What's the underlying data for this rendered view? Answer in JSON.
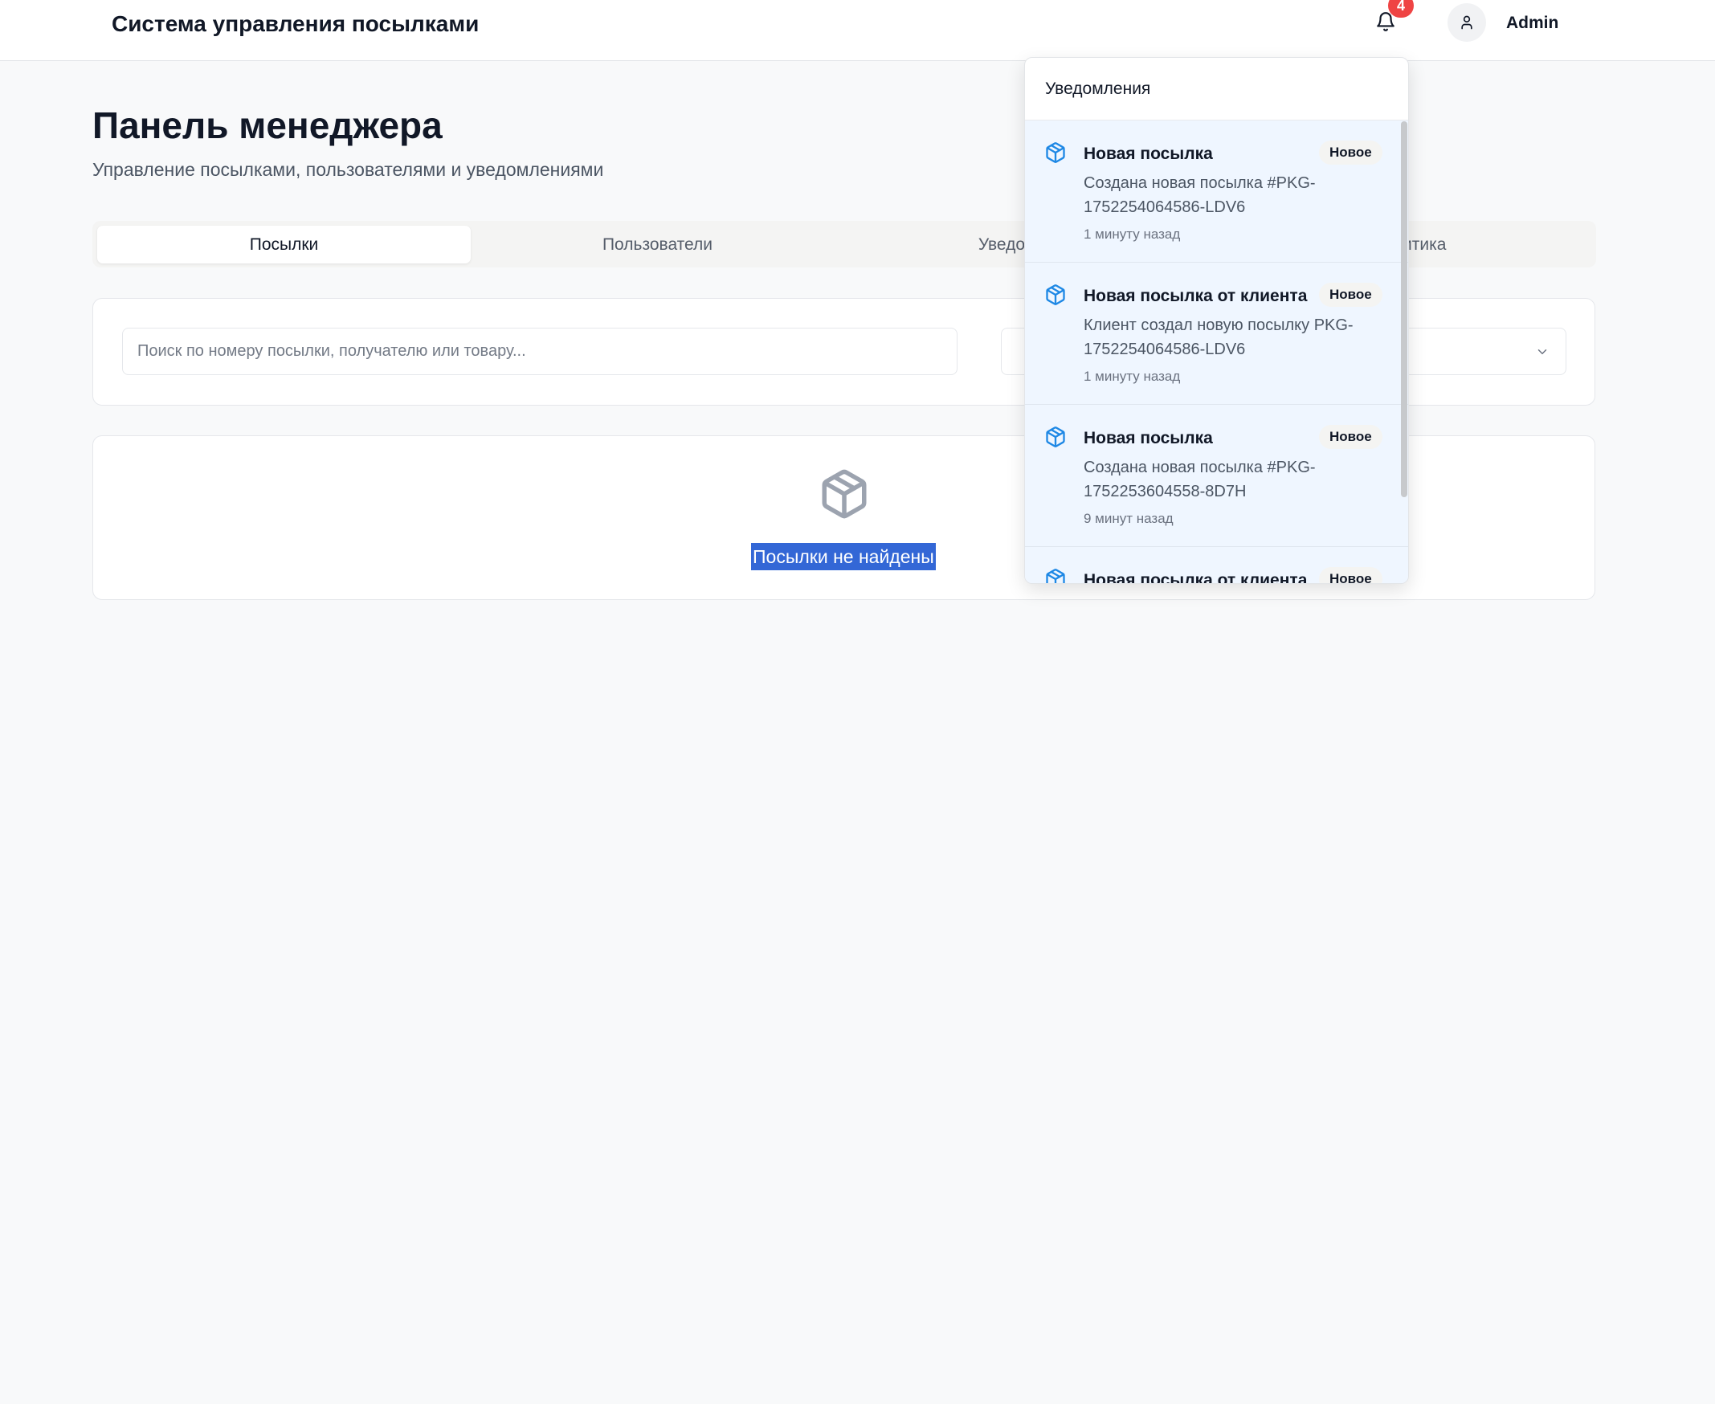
{
  "header": {
    "app_title": "Система управления посылками",
    "notification_count": "4",
    "user_name": "Admin"
  },
  "page": {
    "title": "Панель менеджера",
    "subtitle": "Управление посылками, пользователями и уведомлениями"
  },
  "tabs": [
    {
      "label": "Посылки",
      "active": true
    },
    {
      "label": "Пользователи",
      "active": false
    },
    {
      "label": "Уведомления",
      "active": false
    },
    {
      "label": "Аналитика",
      "active": false
    }
  ],
  "search": {
    "placeholder": "Поиск по номеру посылки, получателю или товару..."
  },
  "empty_state": {
    "text": "Посылки не найдены",
    "icon": "package-icon"
  },
  "notifications": {
    "title": "Уведомления",
    "items": [
      {
        "title": "Новая посылка",
        "badge": "Новое",
        "message": "Создана новая посылка #PKG-1752254064586-LDV6",
        "time": "1 минуту назад",
        "icon": "package-icon"
      },
      {
        "title": "Новая посылка от клиента",
        "badge": "Новое",
        "message": "Клиент создал новую посылку PKG-1752254064586-LDV6",
        "time": "1 минуту назад",
        "icon": "package-icon"
      },
      {
        "title": "Новая посылка",
        "badge": "Новое",
        "message": "Создана новая посылка #PKG-1752253604558-8D7H",
        "time": "9 минут назад",
        "icon": "package-icon"
      },
      {
        "title": "Новая посылка от клиента",
        "badge": "Новое",
        "message": "",
        "time": "",
        "icon": "package-icon"
      }
    ]
  },
  "colors": {
    "badge": "#ef4444",
    "accent_icon": "#1e88e5",
    "notification_bg": "#eff6ff",
    "selection": "#3367d6"
  }
}
